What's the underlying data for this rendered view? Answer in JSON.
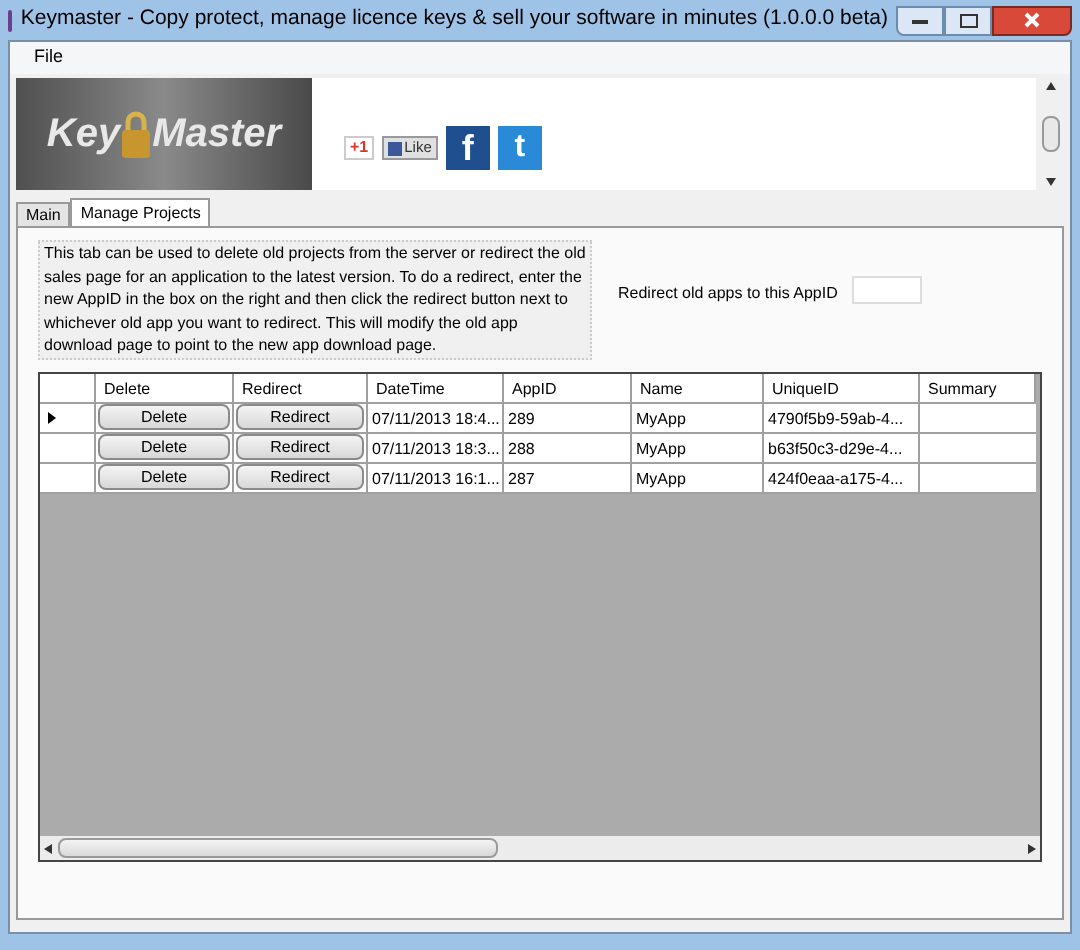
{
  "window": {
    "title": "Keymaster - Copy protect, manage licence keys & sell your software in minutes (1.0.0.0 beta)"
  },
  "menu": [
    "File"
  ],
  "banner": {
    "logo": {
      "left": "Key",
      "right": "Master"
    },
    "plus_one": "+1",
    "like": "Like",
    "facebook": "f",
    "twitter": "t"
  },
  "tabs": [
    {
      "label": "Main",
      "selected": false
    },
    {
      "label": "Manage Projects",
      "selected": true
    }
  ],
  "description": "This tab can be used to delete old projects from the server or redirect the old sales page for an application to the latest version.  To do a redirect, enter the new AppID in the box on the right and then click the redirect button next to whichever old app you want to redirect.  This will modify the old app download page to point to the new app download page.",
  "redirect_label": "Redirect old apps to this AppID",
  "table": {
    "columns": [
      "Delete",
      "Redirect",
      "DateTime",
      "AppID",
      "Name",
      "UniqueID",
      "Summary"
    ],
    "rows": [
      {
        "selected": true,
        "delete": "Delete",
        "redirect": "Redirect",
        "datetime": "07/11/2013 18:4...",
        "appid": "289",
        "name": "MyApp",
        "uniqueid": "4790f5b9-59ab-4..."
      },
      {
        "selected": false,
        "delete": "Delete",
        "redirect": "Redirect",
        "datetime": "07/11/2013 18:3...",
        "appid": "288",
        "name": "MyApp",
        "uniqueid": "b63f50c3-d29e-4..."
      },
      {
        "selected": false,
        "delete": "Delete",
        "redirect": "Redirect",
        "datetime": "07/11/2013 16:1...",
        "appid": "287",
        "name": "MyApp",
        "uniqueid": "424f0eaa-a175-4..."
      }
    ]
  }
}
